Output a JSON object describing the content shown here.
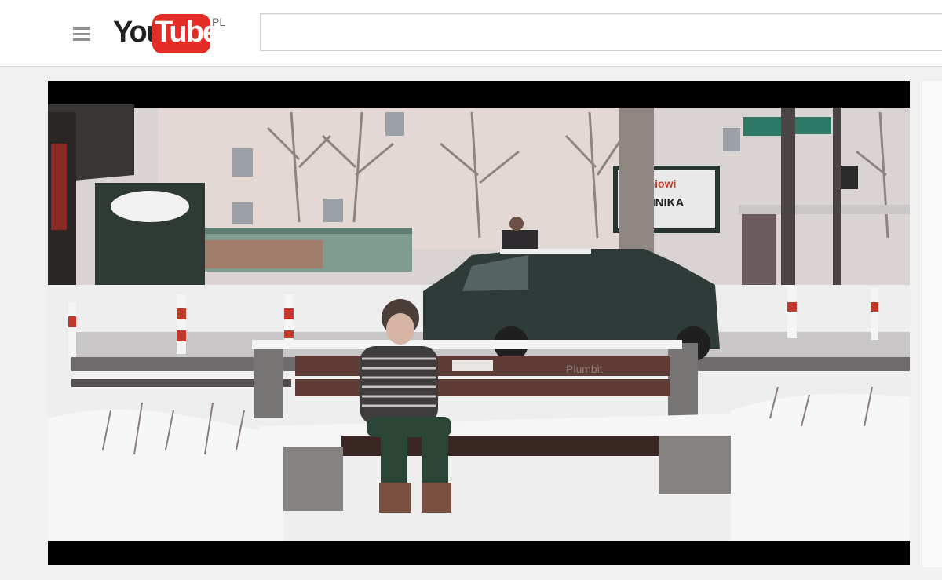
{
  "header": {
    "logo": {
      "you": "You",
      "tube": "Tube",
      "region": "PL"
    },
    "search": {
      "value": "",
      "placeholder": ""
    },
    "menu_icon": "hamburger-menu-icon"
  },
  "player": {
    "scene": "snowy-street-boy-on-bench",
    "storefront_sign_line1": "yczniowi",
    "storefront_sign_line2": "ECHNIKA",
    "bench_graffiti": "Plumbit"
  },
  "colors": {
    "brand_red": "#e52d27",
    "page_bg": "#f1f1f1",
    "player_bg": "#000000"
  }
}
